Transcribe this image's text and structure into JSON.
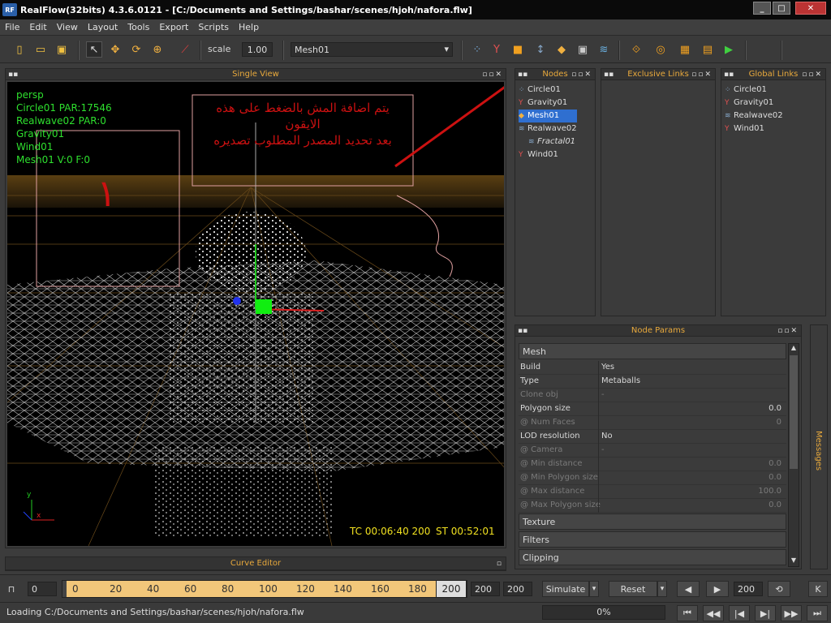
{
  "window": {
    "title": "RealFlow(32bits) 4.3.6.0121 - [C:/Documents and Settings/bashar/scenes/hjoh/nafora.flw]",
    "logo": "RF"
  },
  "menu": [
    "File",
    "Edit",
    "View",
    "Layout",
    "Tools",
    "Export",
    "Scripts",
    "Help"
  ],
  "toolbar": {
    "scale_label": "scale",
    "scale_value": "1.00",
    "node_select": "Mesh01"
  },
  "viewport": {
    "title": "Single View",
    "hud_lines": [
      "persp",
      "Circle01 PAR:17546",
      "Realwave02 PAR:0",
      "Gravity01",
      "Wind01",
      "Mesh01 V:0 F:0"
    ],
    "annotation_lines": [
      "يتم اضافة المش بالضغط على هذه",
      "الايقون",
      "بعد تحديد المصدر المطلوب تصديره"
    ],
    "marker_number": "١",
    "timecode": "TC 00:06:40 200",
    "st": "ST 00:52:01",
    "axis_labels": {
      "x": "x",
      "y": "y"
    }
  },
  "nodes_panel": {
    "title": "Nodes",
    "items": [
      {
        "label": "Circle01",
        "icon": "emitter-icon"
      },
      {
        "label": "Gravity01",
        "icon": "daemon-icon"
      },
      {
        "label": "Mesh01",
        "icon": "mesh-icon",
        "selected": true
      },
      {
        "label": "Realwave02",
        "icon": "realwave-icon"
      },
      {
        "label": "Fractal01",
        "icon": "fractal-icon",
        "child": true
      },
      {
        "label": "Wind01",
        "icon": "daemon-icon"
      }
    ]
  },
  "exclusive_links": {
    "title": "Exclusive Links"
  },
  "global_links": {
    "title": "Global Links",
    "items": [
      "Circle01",
      "Gravity01",
      "Realwave02",
      "Wind01"
    ]
  },
  "node_params": {
    "title": "Node Params",
    "section": "Mesh",
    "rows": [
      {
        "k": "Build",
        "v": "Yes",
        "align": "l"
      },
      {
        "k": "Type",
        "v": "Metaballs",
        "align": "l"
      },
      {
        "k": "Clone obj",
        "v": "-",
        "align": "l",
        "dis": true
      },
      {
        "k": "Polygon size",
        "v": "0.0",
        "align": "r"
      },
      {
        "k": "@ Num Faces",
        "v": "0",
        "align": "r",
        "dis": true
      },
      {
        "k": "LOD resolution",
        "v": "No",
        "align": "l"
      },
      {
        "k": "@ Camera",
        "v": "-",
        "align": "l",
        "dis": true
      },
      {
        "k": "@ Min distance",
        "v": "0.0",
        "align": "r",
        "dis": true
      },
      {
        "k": "@ Min Polygon size",
        "v": "0.0",
        "align": "r",
        "dis": true
      },
      {
        "k": "@ Max distance",
        "v": "100.0",
        "align": "r",
        "dis": true
      },
      {
        "k": "@ Max Polygon size",
        "v": "0.0",
        "align": "r",
        "dis": true
      }
    ],
    "sections": [
      "Texture",
      "Filters",
      "Clipping"
    ]
  },
  "messages_tab": "Messages",
  "curve_editor": {
    "title": "Curve Editor"
  },
  "timeline": {
    "start": "0",
    "ticks": [
      "0",
      "20",
      "40",
      "60",
      "80",
      "100",
      "120",
      "140",
      "160",
      "180"
    ],
    "current": "200",
    "end1": "200",
    "end2": "200",
    "simulate": "Simulate",
    "reset": "Reset",
    "frame": "200",
    "k": "K"
  },
  "status": {
    "text": "Loading C:/Documents and Settings/bashar/scenes/hjoh/nafora.flw",
    "progress": "0%"
  },
  "colors": {
    "accent": "#e8a93c",
    "hud": "#2ee02e",
    "selection": "#2f6fd0",
    "timeline": "#f2c77a",
    "annotation": "#cc1111"
  }
}
